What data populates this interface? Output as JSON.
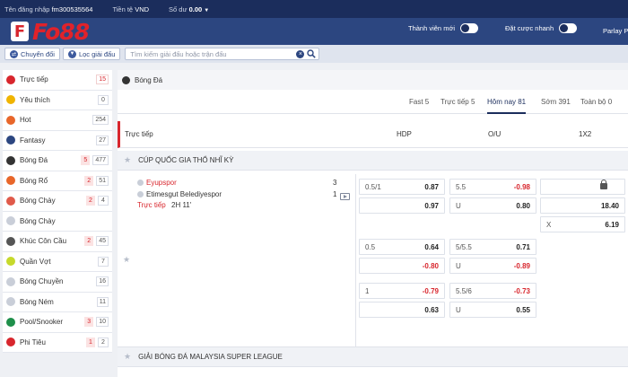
{
  "topbar": {
    "username_label": "Tên đăng nhập",
    "username": "fm300535564",
    "currency_label": "Tiền tệ",
    "currency": "VND",
    "balance_label": "Số dư",
    "balance": "0.00"
  },
  "header": {
    "logo_text": "Fo88",
    "logo_mark": "F",
    "new_member_label": "Thành viên mới",
    "quick_bet_label": "Đặt cược nhanh",
    "parlay_label": "Parlay P"
  },
  "filters": {
    "switch_label": "Chuyển đổi",
    "league_filter_label": "Lọc giải đấu",
    "search_placeholder": "Tìm kiếm giải đấu hoặc trận đấu"
  },
  "sidebar": {
    "items": [
      {
        "label": "Trực tiếp",
        "count": "15",
        "live": "",
        "icon_color": "#d8262d",
        "icon": "live-icon",
        "red": true
      },
      {
        "label": "Yêu thích",
        "count": "0",
        "live": "",
        "icon_color": "#f0b400",
        "icon": "star-icon",
        "red": false
      },
      {
        "label": "Hot",
        "count": "254",
        "live": "",
        "icon_color": "#e8662a",
        "icon": "fire-icon",
        "red": false
      },
      {
        "label": "Fantasy",
        "count": "27",
        "live": "",
        "icon_color": "#2c4680",
        "icon": "fantasy-icon",
        "red": false
      },
      {
        "label": "Bóng Đá",
        "count": "477",
        "live": "5",
        "icon_color": "#333333",
        "icon": "soccer-ball-icon",
        "red": false
      },
      {
        "label": "Bóng Rổ",
        "count": "51",
        "live": "2",
        "icon_color": "#e8662a",
        "icon": "basketball-icon",
        "red": false
      },
      {
        "label": "Bóng Chày",
        "count": "4",
        "live": "2",
        "icon_color": "#e05a4a",
        "icon": "baseball-icon",
        "red": false
      },
      {
        "label": "Bóng Chày",
        "count": "",
        "live": "",
        "icon_color": "#c9ced8",
        "icon": "baseball-icon",
        "red": false
      },
      {
        "label": "Khúc Côn Cầu",
        "count": "45",
        "live": "2",
        "icon_color": "#555555",
        "icon": "hockey-icon",
        "red": false
      },
      {
        "label": "Quần Vợt",
        "count": "7",
        "live": "",
        "icon_color": "#c6d92b",
        "icon": "tennis-icon",
        "red": false
      },
      {
        "label": "Bóng Chuyền",
        "count": "16",
        "live": "",
        "icon_color": "#c9ced8",
        "icon": "volleyball-icon",
        "red": false
      },
      {
        "label": "Bóng Ném",
        "count": "11",
        "live": "",
        "icon_color": "#c9ced8",
        "icon": "handball-icon",
        "red": false
      },
      {
        "label": "Pool/Snooker",
        "count": "10",
        "live": "3",
        "icon_color": "#1e8f4a",
        "icon": "pool-icon",
        "red": false
      },
      {
        "label": "Phi Tiêu",
        "count": "2",
        "live": "1",
        "icon_color": "#d8262d",
        "icon": "darts-icon",
        "red": false
      }
    ]
  },
  "content": {
    "sport_title": "Bóng Đá",
    "tabs": [
      {
        "label": "Fast 5"
      },
      {
        "label": "Trực tiếp 5"
      },
      {
        "label": "Hôm nay 81"
      },
      {
        "label": "Sớm 391"
      },
      {
        "label": "Toàn bộ 0"
      }
    ],
    "active_tab": "Hôm nay 81",
    "columns": {
      "live": "Trực tiếp",
      "hdp": "HDP",
      "ou": "O/U",
      "x12": "1X2"
    },
    "leagues": [
      "CÚP QUỐC GIA THỔ NHĨ KỲ",
      "GIẢI BÓNG ĐÁ MALAYSIA SUPER LEAGUE"
    ],
    "match": {
      "home": "Eyupspor",
      "away": "Etimesgut Belediyespor",
      "home_score": "3",
      "away_score": "1",
      "status": "Trực tiếp",
      "time": "2H 11'",
      "hdp": [
        {
          "line": "0.5/1",
          "odds": "0.87"
        },
        {
          "line": "",
          "odds": "0.97"
        },
        {
          "line": "0.5",
          "odds": "0.64"
        },
        {
          "line": "",
          "odds": "-0.80"
        },
        {
          "line": "1",
          "odds": "-0.79"
        },
        {
          "line": "",
          "odds": "0.63"
        }
      ],
      "ou": [
        {
          "line": "5.5",
          "odds": "-0.98"
        },
        {
          "line": "U",
          "odds": "0.80"
        },
        {
          "line": "5/5.5",
          "odds": "0.71"
        },
        {
          "line": "U",
          "odds": "-0.89"
        },
        {
          "line": "5.5/6",
          "odds": "-0.73"
        },
        {
          "line": "U",
          "odds": "0.55"
        }
      ],
      "x12": [
        {
          "line": "",
          "odds": ""
        },
        {
          "line": "",
          "odds": "18.40"
        },
        {
          "line": "X",
          "odds": "6.19"
        }
      ]
    }
  }
}
